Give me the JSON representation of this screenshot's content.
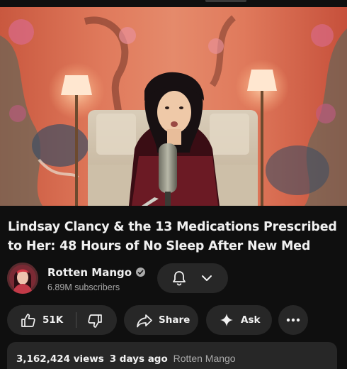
{
  "video": {
    "title": "Lindsay Clancy & the 13 Medications Prescribed to Her: 48 Hours of No Sleep After New Med"
  },
  "channel": {
    "name": "Rotten Mango",
    "subscribers": "6.89M subscribers",
    "verified": true
  },
  "actions": {
    "like_count": "51K",
    "share_label": "Share",
    "ask_label": "Ask"
  },
  "description": {
    "views": "3,162,424 views",
    "age": "3 days ago",
    "channel_tag": "Rotten Mango"
  },
  "icons": {
    "subscribe": "bell-icon",
    "subscribe_menu": "chevron-down-icon",
    "like": "thumbs-up-icon",
    "dislike": "thumbs-down-icon",
    "share": "share-arrow-icon",
    "ask": "sparkle-icon",
    "more": "more-horizontal-icon",
    "verified": "verified-check-icon"
  },
  "colors": {
    "background": "#0f0f0f",
    "pill": "#272727",
    "text_primary": "#f1f1f1",
    "text_secondary": "#aaaaaa"
  }
}
